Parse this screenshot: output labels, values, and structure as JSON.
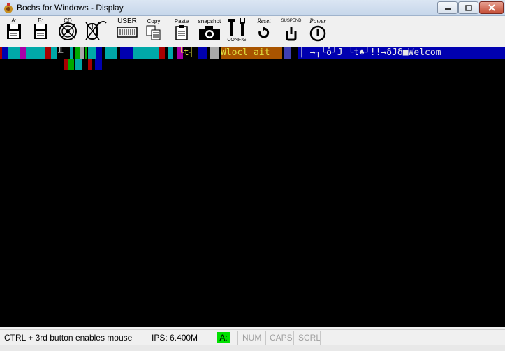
{
  "window": {
    "title": "Bochs for Windows - Display",
    "icon": "bochs-app-icon",
    "controls": {
      "minimize": "minimize-icon",
      "maximize": "maximize-icon",
      "close": "close-icon"
    }
  },
  "toolbar": {
    "floppy_a": {
      "label": "A:",
      "icon": "floppy-a-icon"
    },
    "floppy_b": {
      "label": "B:",
      "icon": "floppy-b-icon"
    },
    "cdrom": {
      "label": "CD",
      "icon": "cdrom-icon"
    },
    "mouse": {
      "label": "",
      "icon": "mouse-icon"
    },
    "user": {
      "label": "USER",
      "icon": "keyboard-icon"
    },
    "copy": {
      "label": "Copy",
      "icon": "copy-icon"
    },
    "paste": {
      "label": "Paste",
      "icon": "paste-icon"
    },
    "snapshot": {
      "label": "snapshot",
      "icon": "camera-icon"
    },
    "config": {
      "label": "CONFIG",
      "icon": "config-tools-icon"
    },
    "reset": {
      "label": "Reset",
      "icon": "reset-icon"
    },
    "suspend": {
      "label": "SUSPEND",
      "icon": "suspend-icon"
    },
    "power": {
      "label": "Power",
      "icon": "power-icon"
    }
  },
  "display": {
    "row1_literal": "Wlocl ait",
    "row1_text": "│ →┐└ô┘J  └t♠┘!!→δJδ■Welcom",
    "row1_glyphs_left": "╨",
    "row1_glyphs_mid": "└t┤",
    "colors": {
      "cyan": "#00a8a8",
      "blue": "#0000b0",
      "magenta": "#a800a8",
      "red": "#a80000",
      "green": "#00a800",
      "brown": "#a85400",
      "gray": "#a8a8a8"
    }
  },
  "status": {
    "mouse_hint": "CTRL + 3rd button enables mouse",
    "ips": "IPS: 6.400M",
    "drive": "A:",
    "num": "NUM",
    "caps": "CAPS",
    "scrl": "SCRL"
  }
}
